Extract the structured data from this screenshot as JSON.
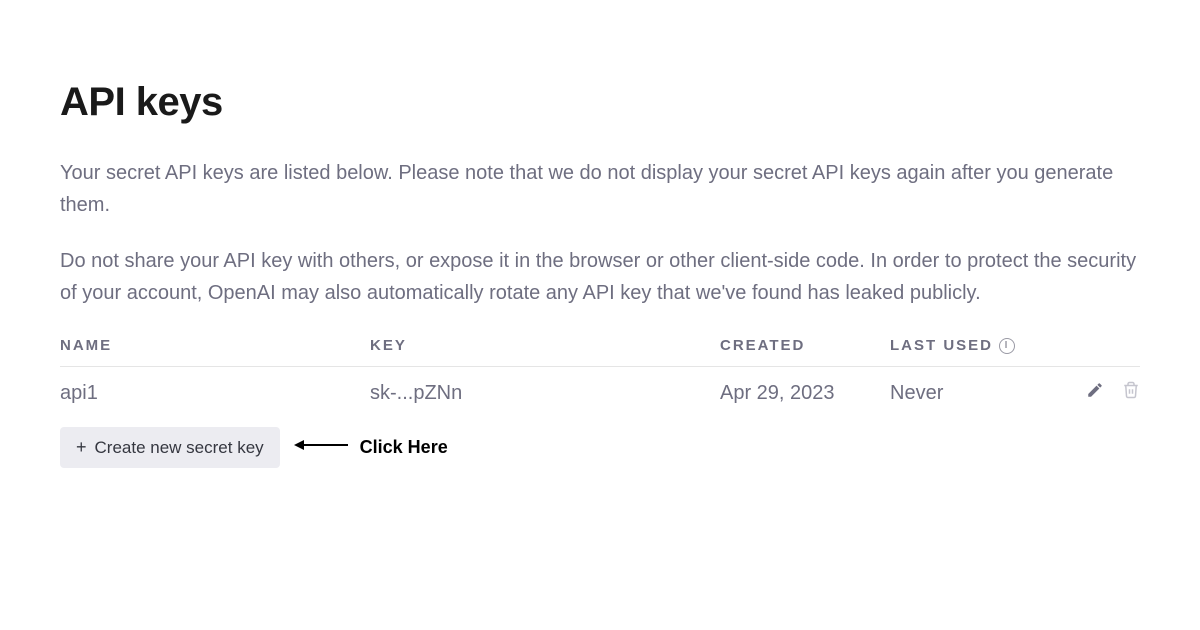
{
  "page": {
    "title": "API keys",
    "desc1": "Your secret API keys are listed below. Please note that we do not display your secret API keys again after you generate them.",
    "desc2": "Do not share your API key with others, or expose it in the browser or other client-side code. In order to protect the security of your account, OpenAI may also automatically rotate any API key that we've found has leaked publicly."
  },
  "table": {
    "headers": {
      "name": "NAME",
      "key": "KEY",
      "created": "CREATED",
      "last_used": "LAST USED"
    },
    "rows": [
      {
        "name": "api1",
        "key": "sk-...pZNn",
        "created": "Apr 29, 2023",
        "last_used": "Never"
      }
    ]
  },
  "create_button_label": "Create new secret key",
  "annotation": {
    "text": "Click Here"
  }
}
